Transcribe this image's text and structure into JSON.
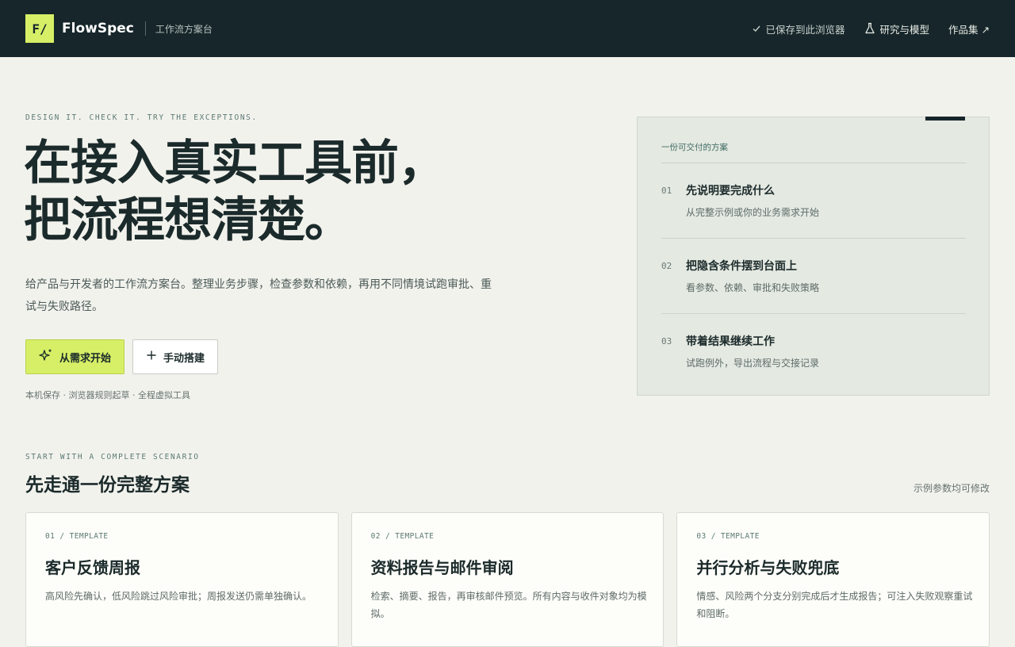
{
  "header": {
    "logo_text": "F/",
    "brand_name": "FlowSpec",
    "brand_subtitle": "工作流方案台",
    "nav": {
      "saved": "已保存到此浏览器",
      "research": "研究与模型",
      "portfolio": "作品集 ↗"
    }
  },
  "hero": {
    "eyebrow": "DESIGN IT. CHECK IT. TRY THE EXCEPTIONS.",
    "title_line1": "在接入真实工具前，",
    "title_line2": "把流程想清楚。",
    "description": "给产品与开发者的工作流方案台。整理业务步骤，检查参数和依赖，再用不同情境试跑审批、重试与失败路径。",
    "primary_button": "从需求开始",
    "secondary_button": "手动搭建",
    "note": "本机保存 · 浏览器规则起草 · 全程虚拟工具"
  },
  "panel": {
    "label": "一份可交付的方案",
    "steps": [
      {
        "num": "01",
        "title": "先说明要完成什么",
        "desc": "从完整示例或你的业务需求开始"
      },
      {
        "num": "02",
        "title": "把隐含条件摆到台面上",
        "desc": "看参数、依赖、审批和失败策略"
      },
      {
        "num": "03",
        "title": "带着结果继续工作",
        "desc": "试跑例外，导出流程与交接记录"
      }
    ]
  },
  "section": {
    "eyebrow": "START WITH A COMPLETE SCENARIO",
    "title": "先走通一份完整方案",
    "note": "示例参数均可修改"
  },
  "templates": [
    {
      "tag": "01 / TEMPLATE",
      "title": "客户反馈周报",
      "desc": "高风险先确认，低风险跳过风险审批；周报发送仍需单独确认。"
    },
    {
      "tag": "02 / TEMPLATE",
      "title": "资料报告与邮件审阅",
      "desc": "检索、摘要、报告，再审核邮件预览。所有内容与收件对象均为模拟。"
    },
    {
      "tag": "03 / TEMPLATE",
      "title": "并行分析与失败兜底",
      "desc": "情感、风险两个分支分别完成后才生成报告；可注入失败观察重试和阻断。"
    }
  ],
  "colors": {
    "header_bg": "#16262a",
    "accent": "#d6ef66",
    "page_bg": "#f2f2ed",
    "panel_bg": "#e4e9e2"
  },
  "icons": {
    "check": "check-icon",
    "flask": "flask-icon",
    "sparkle": "sparkle-icon",
    "plus": "plus-icon"
  }
}
